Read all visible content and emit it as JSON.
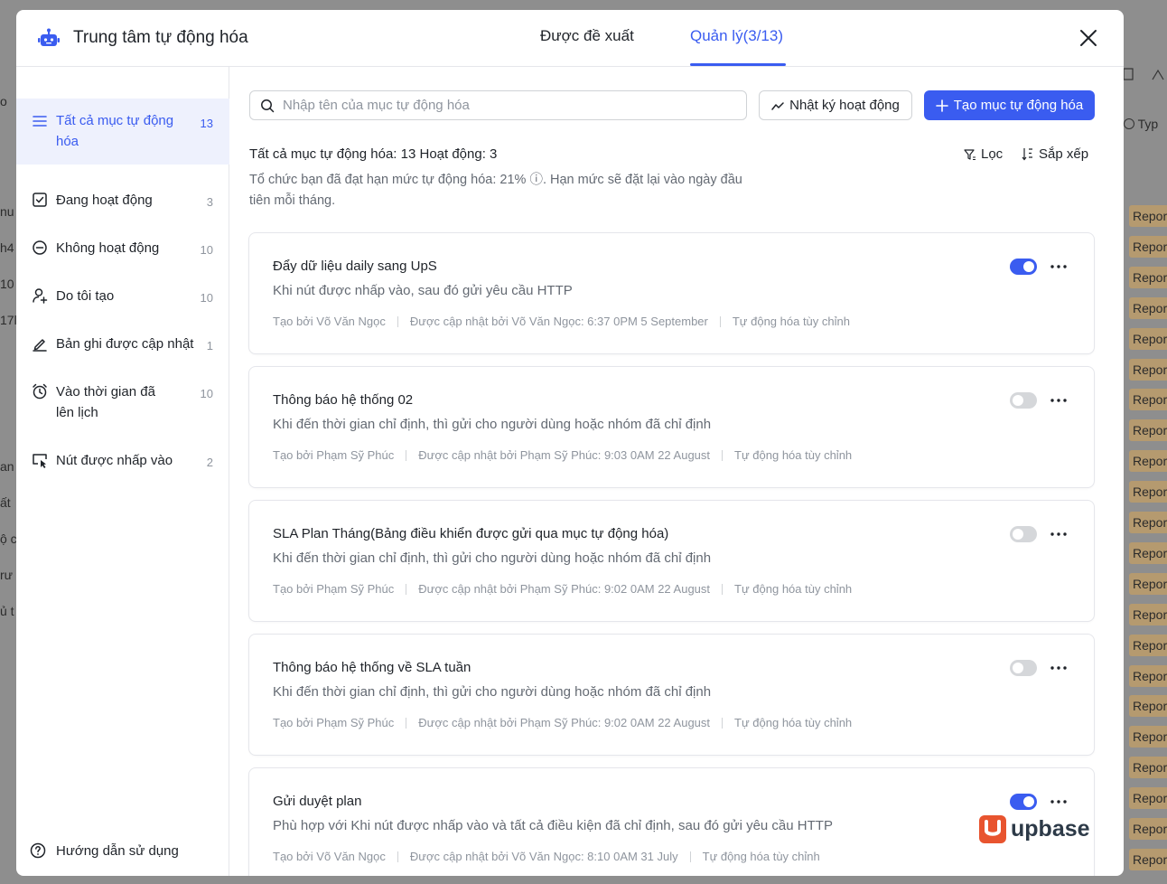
{
  "backdrop": {
    "left_fragments": [
      "o",
      "nu",
      "h4",
      "10",
      "17l",
      "an",
      "ất",
      "ộ c",
      "rư",
      "ủ t"
    ],
    "right_type": "Typ",
    "report_label": "Repor",
    "report_count": 22
  },
  "header": {
    "title": "Trung tâm tự động hóa",
    "tabs": [
      {
        "label": "Được đề xuất",
        "active": false
      },
      {
        "label": "Quản lý(3/13)",
        "active": true
      }
    ]
  },
  "sidebar": {
    "items": [
      {
        "label": "Tất cả mục tự động hóa",
        "count": "13",
        "icon": "list-icon",
        "active": true
      },
      {
        "label": "Đang hoạt động",
        "count": "3",
        "icon": "checkbox-icon"
      },
      {
        "label": "Không hoạt động",
        "count": "10",
        "icon": "minus-circle-icon"
      },
      {
        "label": "Do tôi tạo",
        "count": "10",
        "icon": "user-plus-icon"
      },
      {
        "label": "Bản ghi được cập nhật",
        "count": "1",
        "icon": "pencil-icon"
      },
      {
        "label": "Vào thời gian đã lên lịch",
        "count": "10",
        "icon": "alarm-clock-icon"
      },
      {
        "label": "Nút được nhấp vào",
        "count": "2",
        "icon": "cursor-click-icon"
      }
    ],
    "help": "Hướng dẫn sử dụng"
  },
  "toolbar": {
    "search_placeholder": "Nhập tên của mục tự động hóa",
    "log_label": "Nhật ký hoạt động",
    "create_label": "Tạo mục tự động hóa"
  },
  "summary": {
    "text": "Tất cả mục tự động hóa: 13 Hoạt động: 3",
    "filter_label": "Lọc",
    "sort_label": "Sắp xếp",
    "quota_text": "Tổ chức bạn đã đạt hạn mức tự động hóa: 21% ⓘ. Hạn mức sẽ đặt lại vào ngày đầu tiên mỗi tháng."
  },
  "automations": [
    {
      "title": "Đẩy dữ liệu daily sang UpS",
      "description": "Khi nút được nhấp vào, sau đó gửi yêu cầu HTTP",
      "created_by": "Tạo bởi Võ Văn Ngọc",
      "updated_by": "Được cập nhật bởi Võ Văn Ngọc: 6:37 0PM 5 September",
      "type": "Tự động hóa tùy chỉnh",
      "enabled": true
    },
    {
      "title": "Thông báo hệ thống 02",
      "description": "Khi đến thời gian chỉ định, thì gửi cho người dùng hoặc nhóm đã chỉ định",
      "created_by": "Tạo bởi Phạm Sỹ Phúc",
      "updated_by": "Được cập nhật bởi Phạm Sỹ Phúc: 9:03 0AM 22 August",
      "type": "Tự động hóa tùy chỉnh",
      "enabled": false
    },
    {
      "title": "SLA Plan Tháng(Bảng điều khiển được gửi qua mục tự động hóa)",
      "description": "Khi đến thời gian chỉ định, thì gửi cho người dùng hoặc nhóm đã chỉ định",
      "created_by": "Tạo bởi Phạm Sỹ Phúc",
      "updated_by": "Được cập nhật bởi Phạm Sỹ Phúc: 9:02 0AM 22 August",
      "type": "Tự động hóa tùy chỉnh",
      "enabled": false
    },
    {
      "title": "Thông báo hệ thống về SLA tuần",
      "description": "Khi đến thời gian chỉ định, thì gửi cho người dùng hoặc nhóm đã chỉ định",
      "created_by": "Tạo bởi Phạm Sỹ Phúc",
      "updated_by": "Được cập nhật bởi Phạm Sỹ Phúc: 9:02 0AM 22 August",
      "type": "Tự động hóa tùy chỉnh",
      "enabled": false
    },
    {
      "title": "Gửi duyệt plan",
      "description": "Phù hợp với Khi nút được nhấp vào và tất cả điều kiện đã chỉ định, sau đó gửi yêu cầu HTTP",
      "created_by": "Tạo bởi Võ Văn Ngọc",
      "updated_by": "Được cập nhật bởi Võ Văn Ngọc: 8:10 0AM 31 July",
      "type": "Tự động hóa tùy chỉnh",
      "enabled": true
    }
  ],
  "watermark": {
    "brand": "upbase"
  },
  "colors": {
    "accent": "#3a5cf0",
    "brand_orange": "#e8542f"
  }
}
